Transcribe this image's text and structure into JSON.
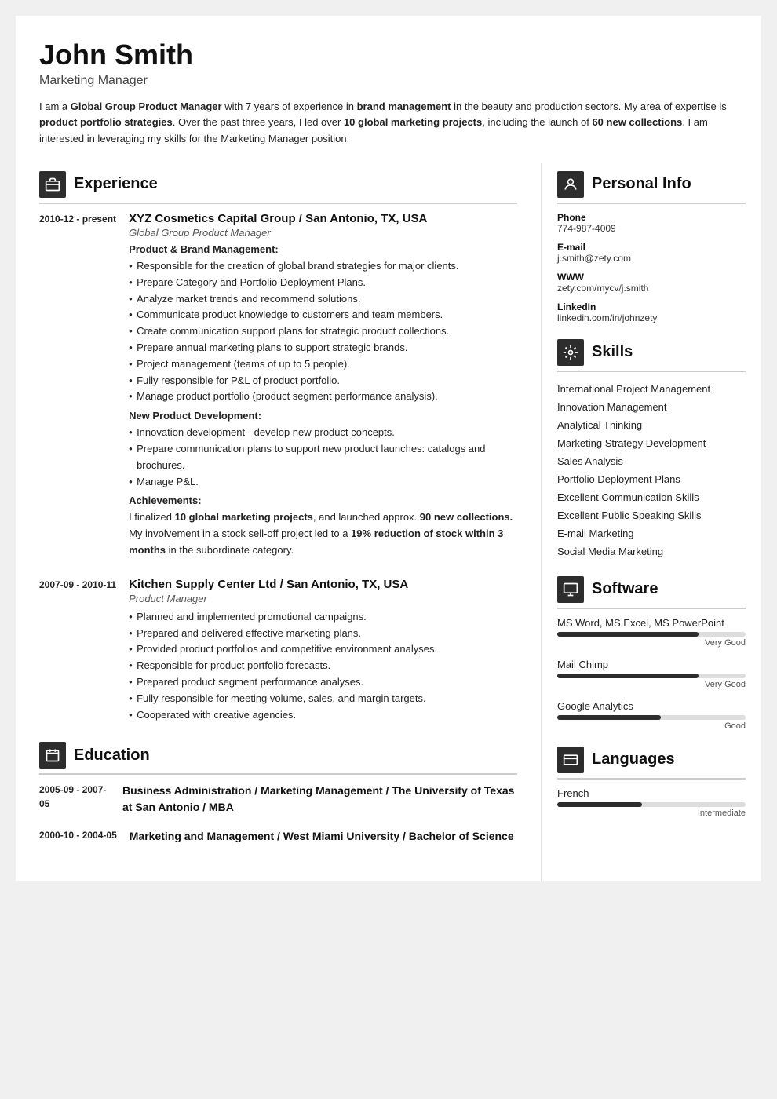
{
  "header": {
    "name": "John Smith",
    "title": "Marketing Manager",
    "summary": "I am a Global Group Product Manager with 7 years of experience in brand management in the beauty and production sectors. My area of expertise is product portfolio strategies. Over the past three years, I led over 10 global marketing projects, including the launch of 60 new collections. I am interested in leveraging my skills for the Marketing Manager position.",
    "summary_bold_parts": [
      "Global Group Product Manager",
      "brand management",
      "product portfolio strategies",
      "10 global marketing projects",
      "60 new collections"
    ]
  },
  "sections": {
    "experience_label": "Experience",
    "education_label": "Education",
    "personal_info_label": "Personal Info",
    "skills_label": "Skills",
    "software_label": "Software",
    "languages_label": "Languages"
  },
  "experience": [
    {
      "date": "2010-12 - present",
      "company": "XYZ Cosmetics Capital Group / San Antonio, TX, USA",
      "role": "Global Group Product Manager",
      "sections": [
        {
          "header": "Product & Brand Management:",
          "bullets": [
            "Responsible for the creation of global brand strategies for major clients.",
            "Prepare Category and Portfolio Deployment Plans.",
            "Analyze market trends and recommend solutions.",
            "Communicate product knowledge to customers and team members.",
            "Create communication support plans for strategic product collections.",
            "Prepare annual marketing plans to support strategic brands.",
            "Project management (teams of up to 5 people).",
            "Fully responsible for P&L of product portfolio.",
            "Manage product portfolio (product segment performance analysis)."
          ]
        },
        {
          "header": "New Product Development:",
          "bullets": [
            "Innovation development - develop new product concepts.",
            "Prepare communication plans to support new product launches: catalogs and brochures.",
            "Manage P&L."
          ]
        },
        {
          "header": "Achievements:",
          "achievement": "I finalized 10 global marketing projects, and launched approx. 90 new collections.\nMy involvement in a stock sell-off project led to a 19% reduction of stock within 3 months in the subordinate category."
        }
      ]
    },
    {
      "date": "2007-09 - 2010-11",
      "company": "Kitchen Supply Center Ltd / San Antonio, TX, USA",
      "role": "Product Manager",
      "sections": [
        {
          "header": "",
          "bullets": [
            "Planned and implemented promotional campaigns.",
            "Prepared and delivered effective marketing plans.",
            "Provided product portfolios and competitive environment analyses.",
            "Responsible for product portfolio forecasts.",
            "Prepared product segment performance analyses.",
            "Fully responsible for meeting volume, sales, and margin targets.",
            "Cooperated with creative agencies."
          ]
        }
      ]
    }
  ],
  "education": [
    {
      "date": "2005-09 - 2007-05",
      "degree": "Business Administration / Marketing Management / The University of Texas at San Antonio / MBA"
    },
    {
      "date": "2000-10 - 2004-05",
      "degree": "Marketing and Management / West Miami University / Bachelor of Science"
    }
  ],
  "personal_info": {
    "phone_label": "Phone",
    "phone": "774-987-4009",
    "email_label": "E-mail",
    "email": "j.smith@zety.com",
    "www_label": "WWW",
    "www": "zety.com/mycv/j.smith",
    "linkedin_label": "LinkedIn",
    "linkedin": "linkedin.com/in/johnzety"
  },
  "skills": [
    "International Project Management",
    "Innovation Management",
    "Analytical Thinking",
    "Marketing Strategy Development",
    "Sales Analysis",
    "Portfolio Deployment Plans",
    "Excellent Communication Skills",
    "Excellent Public Speaking Skills",
    "E-mail Marketing",
    "Social Media Marketing"
  ],
  "software": [
    {
      "name": "MS Word, MS Excel, MS PowerPoint",
      "level": "Very Good",
      "percent": 75
    },
    {
      "name": "Mail Chimp",
      "level": "Very Good",
      "percent": 75
    },
    {
      "name": "Google Analytics",
      "level": "Good",
      "percent": 55
    }
  ],
  "languages": [
    {
      "name": "French",
      "level": "Intermediate",
      "percent": 45
    }
  ],
  "icons": {
    "experience": "🗂",
    "education": "✉",
    "personal_info": "👤",
    "skills": "⚙",
    "software": "🖥",
    "languages": "🚩"
  }
}
